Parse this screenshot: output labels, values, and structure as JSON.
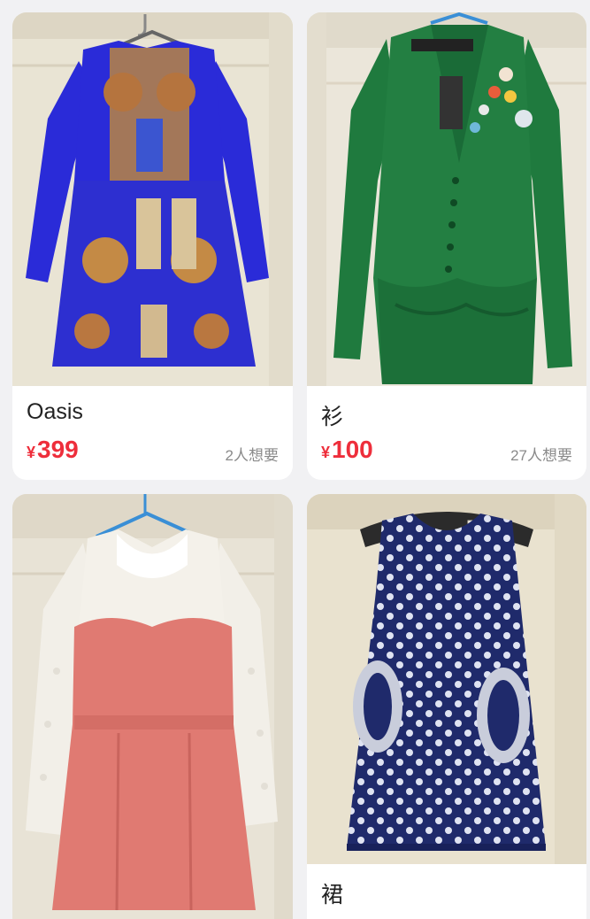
{
  "products": [
    {
      "title": "Oasis",
      "currency": "¥",
      "price": "399",
      "wants": "2人想要",
      "image_subject": "blue long-sleeve printed dress on hanger",
      "dress_color": "#2a2bd8"
    },
    {
      "title": "衫",
      "currency": "¥",
      "price": "100",
      "wants": "27人想要",
      "image_subject": "green button-up cardigan with brooch",
      "dress_color": "#1f7a3e"
    },
    {
      "title": "",
      "currency": "",
      "price": "",
      "wants": "",
      "image_subject": "coral dress with white lace sleeves",
      "dress_color": "#e07a72"
    },
    {
      "title": "裙",
      "currency": "",
      "price": "",
      "wants": "",
      "image_subject": "navy polka-dot sleeveless dress",
      "dress_color": "#1f2a6b"
    }
  ],
  "colors": {
    "background": "#f1f1f3",
    "price": "#ee2e3b",
    "wants": "#8a8a8a",
    "title": "#222222"
  }
}
